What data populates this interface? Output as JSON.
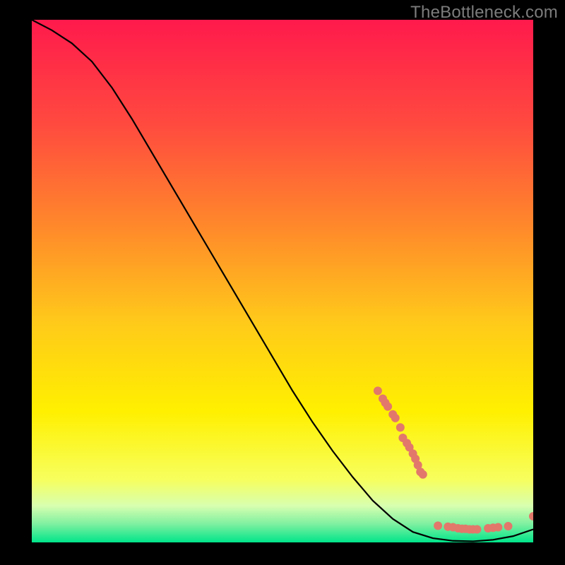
{
  "watermark": "TheBottleneck.com",
  "chart_data": {
    "type": "line",
    "title": "",
    "xlabel": "",
    "ylabel": "",
    "xlim": [
      0,
      100
    ],
    "ylim": [
      0,
      100
    ],
    "grid": false,
    "legend": false,
    "background_gradient_stops": [
      {
        "offset": 0.0,
        "color": "#ff1a4c"
      },
      {
        "offset": 0.2,
        "color": "#ff4a3f"
      },
      {
        "offset": 0.4,
        "color": "#ff8a2a"
      },
      {
        "offset": 0.58,
        "color": "#ffca1a"
      },
      {
        "offset": 0.75,
        "color": "#fff000"
      },
      {
        "offset": 0.88,
        "color": "#f7ff5e"
      },
      {
        "offset": 0.93,
        "color": "#d8ffb0"
      },
      {
        "offset": 0.965,
        "color": "#7ef0a0"
      },
      {
        "offset": 1.0,
        "color": "#00e58a"
      }
    ],
    "series": [
      {
        "name": "bottleneck-curve",
        "color": "#000000",
        "x": [
          0,
          4,
          8,
          12,
          16,
          20,
          24,
          28,
          32,
          36,
          40,
          44,
          48,
          52,
          56,
          60,
          64,
          68,
          72,
          76,
          80,
          84,
          88,
          92,
          96,
          100
        ],
        "y": [
          100,
          98,
          95.5,
          92,
          87,
          81,
          74.5,
          68,
          61.5,
          55,
          48.5,
          42,
          35.5,
          29,
          23,
          17.5,
          12.5,
          8,
          4.5,
          2,
          0.8,
          0.3,
          0.2,
          0.5,
          1.2,
          2.5
        ]
      }
    ],
    "scatter_points": {
      "name": "highlighted-points",
      "color": "#e2786b",
      "radius": 6,
      "points": [
        {
          "x": 69,
          "y": 29
        },
        {
          "x": 70,
          "y": 27.5
        },
        {
          "x": 70.5,
          "y": 26.7
        },
        {
          "x": 71,
          "y": 26
        },
        {
          "x": 72,
          "y": 24.5
        },
        {
          "x": 72.5,
          "y": 23.8
        },
        {
          "x": 73.5,
          "y": 22
        },
        {
          "x": 74,
          "y": 20
        },
        {
          "x": 74.8,
          "y": 19
        },
        {
          "x": 75.3,
          "y": 18.2
        },
        {
          "x": 76,
          "y": 17
        },
        {
          "x": 76.5,
          "y": 16
        },
        {
          "x": 77,
          "y": 14.8
        },
        {
          "x": 77.5,
          "y": 13.5
        },
        {
          "x": 78,
          "y": 13
        },
        {
          "x": 81,
          "y": 3.2
        },
        {
          "x": 83,
          "y": 3
        },
        {
          "x": 84,
          "y": 2.9
        },
        {
          "x": 85,
          "y": 2.7
        },
        {
          "x": 85.8,
          "y": 2.6
        },
        {
          "x": 86.5,
          "y": 2.6
        },
        {
          "x": 87.3,
          "y": 2.5
        },
        {
          "x": 88,
          "y": 2.5
        },
        {
          "x": 88.8,
          "y": 2.5
        },
        {
          "x": 91,
          "y": 2.7
        },
        {
          "x": 92,
          "y": 2.8
        },
        {
          "x": 93,
          "y": 2.9
        },
        {
          "x": 95,
          "y": 3.1
        },
        {
          "x": 100,
          "y": 5
        }
      ]
    }
  }
}
